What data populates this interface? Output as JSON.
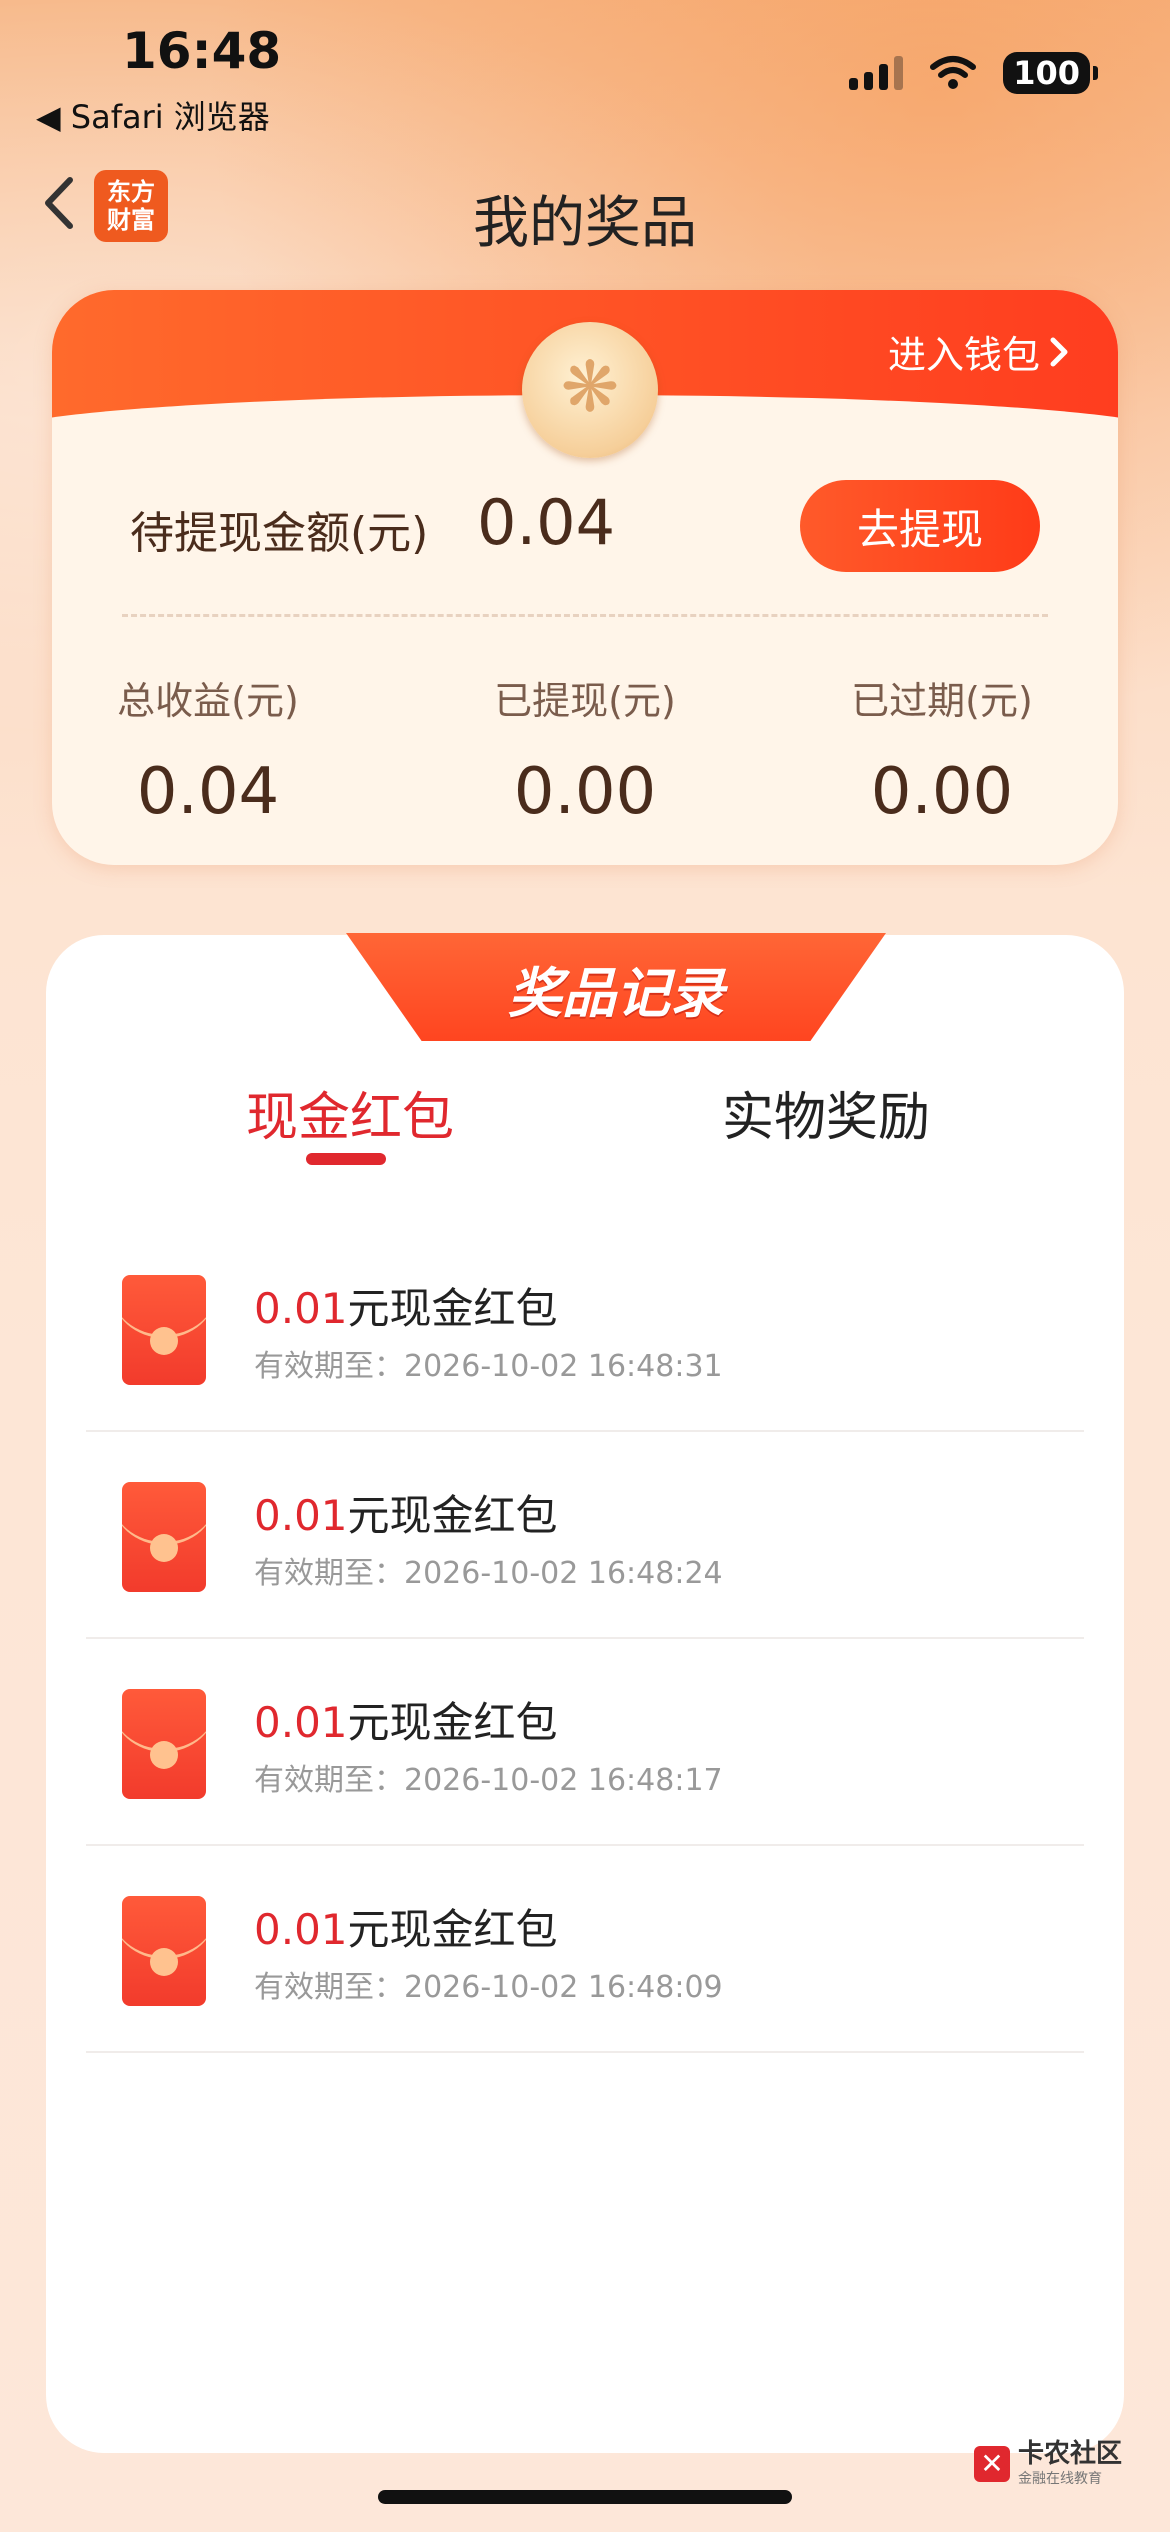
{
  "status_bar": {
    "time": "16:48",
    "back_app": "◀ Safari 浏览器",
    "battery": "100",
    "signal_icon": "cellular-signal-icon",
    "wifi_icon": "wifi-icon"
  },
  "nav": {
    "title": "我的奖品",
    "logo_line1": "东方",
    "logo_line2": "财富"
  },
  "summary": {
    "wallet_link": "进入钱包",
    "pending_label": "待提现金额(元)",
    "pending_value": "0.04",
    "withdraw_button": "去提现",
    "stats": [
      {
        "label": "总收益(元)",
        "value": "0.04"
      },
      {
        "label": "已提现(元)",
        "value": "0.00"
      },
      {
        "label": "已过期(元)",
        "value": "0.00"
      }
    ]
  },
  "records": {
    "ribbon_title": "奖品记录",
    "tabs": [
      {
        "label": "现金红包",
        "active": true
      },
      {
        "label": "实物奖励",
        "active": false
      }
    ],
    "items": [
      {
        "amount": "0.01",
        "suffix": "元现金红包",
        "expiry": "有效期至：2026-10-02 16:48:31"
      },
      {
        "amount": "0.01",
        "suffix": "元现金红包",
        "expiry": "有效期至：2026-10-02 16:48:24"
      },
      {
        "amount": "0.01",
        "suffix": "元现金红包",
        "expiry": "有效期至：2026-10-02 16:48:17"
      },
      {
        "amount": "0.01",
        "suffix": "元现金红包",
        "expiry": "有效期至：2026-10-02 16:48:09"
      }
    ]
  },
  "watermark": {
    "title": "卡农社区",
    "subtitle": "金融在线教育"
  },
  "colors": {
    "accent": "#e0282e",
    "brand_orange": "#ff4a22"
  }
}
